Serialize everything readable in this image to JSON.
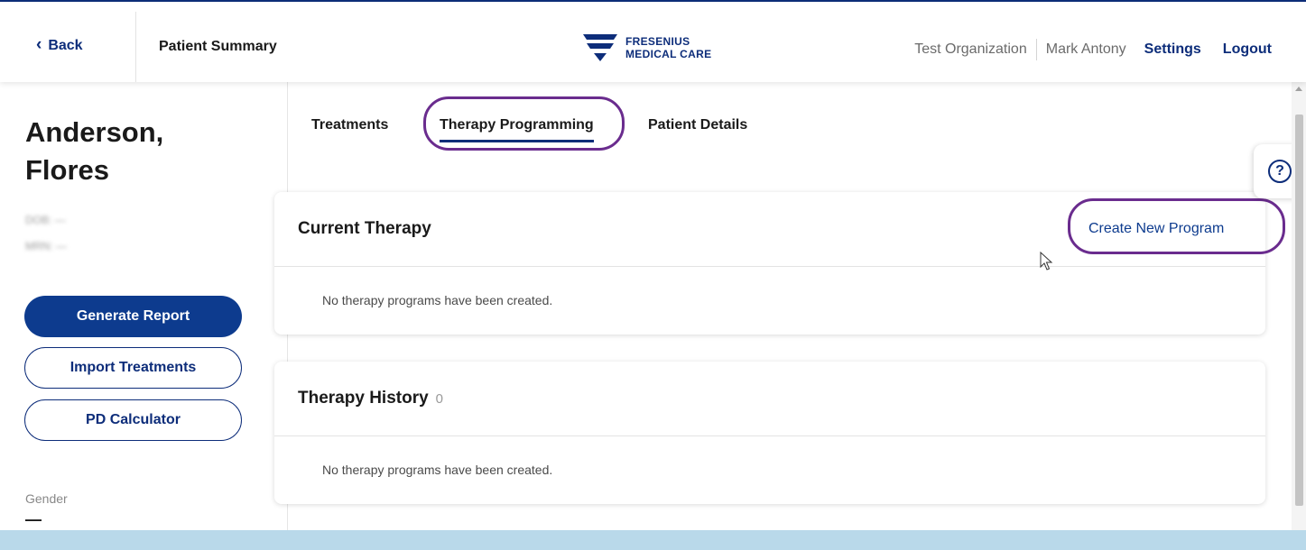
{
  "header": {
    "back_label": "Back",
    "page_title": "Patient Summary",
    "logo_line1": "FRESENIUS",
    "logo_line2": "MEDICAL CARE",
    "organization": "Test Organization",
    "user": "Mark Antony",
    "settings_label": "Settings",
    "logout_label": "Logout"
  },
  "patient": {
    "name_line1": "Anderson,",
    "name_line2": "Flores",
    "dob": "DOB: —",
    "mrn": "MRN: —",
    "gender_label": "Gender",
    "gender_value": "—"
  },
  "sidebar": {
    "generate_report": "Generate Report",
    "import_treatments": "Import Treatments",
    "pd_calculator": "PD Calculator"
  },
  "tabs": [
    {
      "label": "Treatments"
    },
    {
      "label": "Therapy Programming",
      "active": true
    },
    {
      "label": "Patient Details"
    }
  ],
  "current_therapy": {
    "title": "Current Therapy",
    "action_label": "Create New Program",
    "empty_text": "No therapy programs have been created."
  },
  "therapy_history": {
    "title": "Therapy History",
    "count": "0",
    "empty_text": "No therapy programs have been created."
  },
  "help": {
    "icon": "?"
  },
  "colors": {
    "brand_navy": "#0d2d7a",
    "primary_button": "#0d3b8e",
    "highlight_purple": "#6a2c8e",
    "bottom_bar": "#b9d9ea"
  }
}
